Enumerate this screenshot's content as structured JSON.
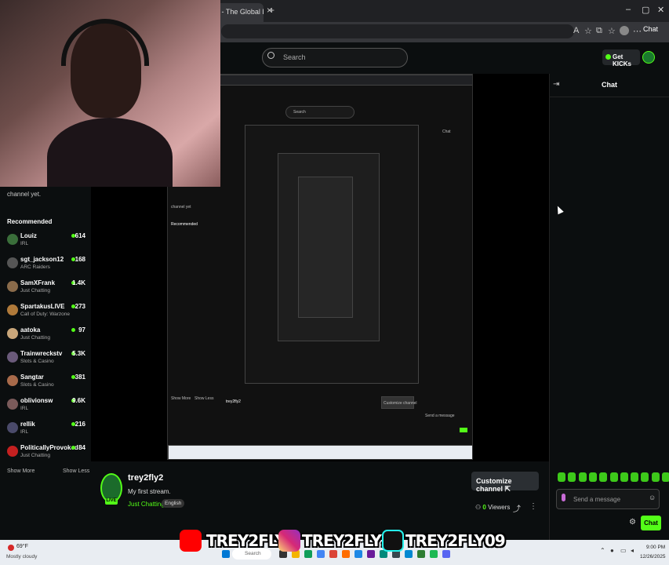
{
  "browser": {
    "tab_title": "ckia - The Global K",
    "tab_close": "×",
    "new_tab": "+",
    "minimize": "–",
    "maximize": "▢",
    "close": "✕",
    "chat_chip": "Chat"
  },
  "header": {
    "search_placeholder": "Search",
    "get_kicks": "Get KICKs"
  },
  "sidebar": {
    "partial_text": "channel yet.",
    "recommended_title": "Recommended",
    "items": [
      {
        "name": "Louiz",
        "category": "IRL",
        "viewers": "614",
        "color": "#3a6e3a"
      },
      {
        "name": "sgt_jackson12",
        "category": "ARC Raiders",
        "viewers": "168",
        "color": "#555555"
      },
      {
        "name": "SamXFrank",
        "category": "Just Chatting",
        "viewers": "1.4K",
        "color": "#8a6b4a"
      },
      {
        "name": "SpartakusLIVE",
        "category": "Call of Duty: Warzone",
        "viewers": "273",
        "color": "#b07a3a"
      },
      {
        "name": "aatoka",
        "category": "Just Chatting",
        "viewers": "97",
        "color": "#c9a67a"
      },
      {
        "name": "Trainwreckstv",
        "category": "Slots & Casino",
        "viewers": "5.3K",
        "color": "#6a5a7a"
      },
      {
        "name": "Sangtar",
        "category": "Slots & Casino",
        "viewers": "381",
        "color": "#a86a4a"
      },
      {
        "name": "oblivionsw",
        "category": "IRL",
        "viewers": "9.6K",
        "color": "#7a5a5a"
      },
      {
        "name": "rellik",
        "category": "IRL",
        "viewers": "216",
        "color": "#4a4a6a"
      },
      {
        "name": "PoliticallyProvoked",
        "category": "Just Chatting",
        "viewers": "84",
        "color": "#c42020"
      }
    ],
    "show_more": "Show More",
    "show_less": "Show Less"
  },
  "stream": {
    "streamer": "trey2fly2",
    "title": "My first stream.",
    "category": "Just Chatting",
    "language": "English",
    "live_badge": "LIVE",
    "customize_button": "Customize channel ⇱",
    "viewers_count": "0",
    "viewers_label": "Viewers",
    "nested_mini": {
      "search": "Search",
      "chat": "Chat",
      "channel_yet": "channel yet",
      "recommended": "Recommended",
      "streamer": "trey2fly2",
      "customize": "Customize channel",
      "send": "Send a message",
      "chat_btn": "Chat",
      "show_more": "Show More",
      "show_less": "Show Less"
    }
  },
  "chat": {
    "title": "Chat",
    "placeholder": "Send a message",
    "send_button": "Chat",
    "emote_count": 11
  },
  "banner": {
    "youtube": "TREY2FLY",
    "instagram": "TREY2FLY2",
    "tiktok": "TREY2FLY09",
    "colors": {
      "youtube": "#ff0000",
      "instagram": "#d62976",
      "tiktok": "#000000"
    }
  },
  "taskbar": {
    "temp": "69°F",
    "weather": "Mostly cloudy",
    "search": "Search",
    "time": "9:00 PM",
    "date": "12/26/2025"
  },
  "colors": {
    "accent": "#53fc18",
    "background": "#0b0e0f"
  }
}
